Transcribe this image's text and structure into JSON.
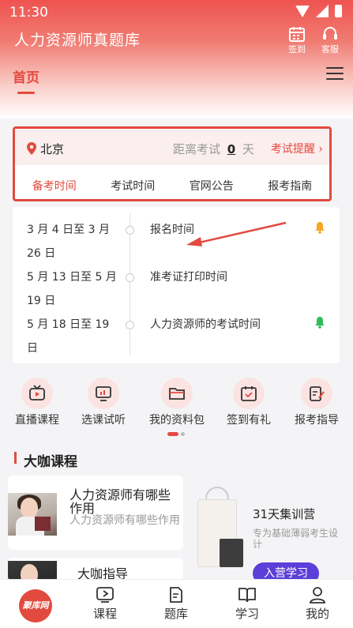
{
  "status": {
    "time": "11:30"
  },
  "header": {
    "title": "人力资源师真题库",
    "checkin_label": "签到",
    "service_label": "客服"
  },
  "nav_tab": {
    "label": "首页"
  },
  "exam": {
    "city": "北京",
    "countdown_prefix": "距离考试",
    "countdown_days": "0",
    "countdown_suffix": "天",
    "reminder_label": "考试提醒",
    "tabs": [
      "备考时间",
      "考试时间",
      "官网公告",
      "报考指南"
    ]
  },
  "timeline": [
    {
      "date": "3 月 4 日至 3 月 26 日",
      "event": "报名时间",
      "bell_color": "#f5a623"
    },
    {
      "date": "5 月 13 日至 5 月 19 日",
      "event": "准考证打印时间"
    },
    {
      "date": "5 月 18 日至 19 日",
      "event": "人力资源师的考试时间",
      "bell_color": "#2ebd59"
    }
  ],
  "quick_links": [
    "直播课程",
    "选课试听",
    "我的资料包",
    "签到有礼",
    "报考指导"
  ],
  "section": {
    "title": "大咖课程"
  },
  "courses": [
    {
      "title": "人力资源师有哪些作用",
      "subtitle": "人力资源师有哪些作用"
    },
    {
      "title": "大咖指导"
    }
  ],
  "promo": {
    "title": "31天集训营",
    "subtitle": "专为基础薄弱考生设计",
    "button": "入营学习"
  },
  "bottom_nav": {
    "logo_text": "聚库网",
    "items": [
      "课程",
      "题库",
      "学习",
      "我的"
    ]
  },
  "colors": {
    "accent": "#e24a3f",
    "promo_button": "#5b3fd8"
  }
}
